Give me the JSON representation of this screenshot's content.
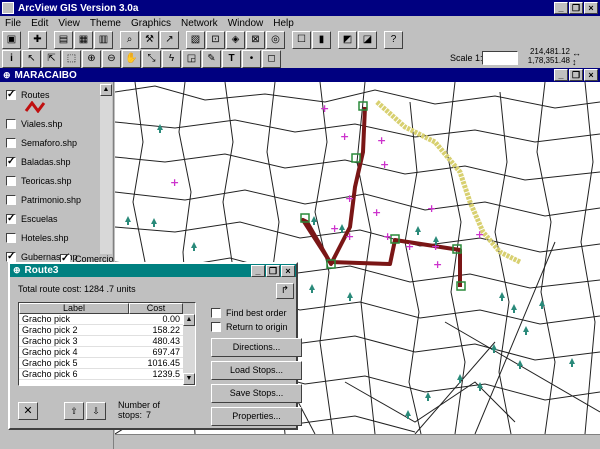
{
  "app": {
    "title": "ArcView GIS Version 3.0a"
  },
  "menu": [
    "File",
    "Edit",
    "View",
    "Theme",
    "Graphics",
    "Network",
    "Window",
    "Help"
  ],
  "scale": {
    "label": "Scale 1:",
    "coord_x": "214,481.12",
    "coord_y": "1,78,351.48"
  },
  "view": {
    "title": "MARACAIBO"
  },
  "toc": {
    "items": [
      {
        "label": "Routes",
        "checked": true
      },
      {
        "label": "Viales.shp",
        "checked": false
      },
      {
        "label": "Semaforo.shp",
        "checked": false
      },
      {
        "label": "Baladas.shp",
        "checked": true
      },
      {
        "label": "Teoricas.shp",
        "checked": false
      },
      {
        "label": "Patrimonio.shp",
        "checked": false
      },
      {
        "label": "Escuelas",
        "checked": true
      },
      {
        "label": "Hoteles.shp",
        "checked": false
      },
      {
        "label": "Gubernas.shp",
        "checked": true
      },
      {
        "label": "Comercio",
        "checked": true
      }
    ]
  },
  "dialog": {
    "title": "Route3",
    "summary": "Total route cost: 1284 .7 units",
    "columns": [
      "Label",
      "Cost"
    ],
    "rows": [
      {
        "label": "Gracho pick",
        "cost": "0.00"
      },
      {
        "label": "Gracho pick 2",
        "cost": "158.22"
      },
      {
        "label": "Gracho pick 3",
        "cost": "480.43"
      },
      {
        "label": "Gracho pick 4",
        "cost": "697.47"
      },
      {
        "label": "Gracho pick 5",
        "cost": "1016.45"
      },
      {
        "label": "Gracho pick 6",
        "cost": "1239.5"
      }
    ],
    "find_best_order": "Find best order",
    "return_to_origin": "Return to origin",
    "buttons": {
      "directions": "Directions...",
      "load_stops": "Load Stops...",
      "save_stops": "Save Stops...",
      "properties": "Properties..."
    },
    "stops_label": "Number of stops:",
    "stops_value": "7"
  },
  "colors": {
    "titlebar": "#000080",
    "route": "#7a1616",
    "facility": "#cc33cc",
    "tree": "#2a8a7a",
    "road_highlight": "#d8d070"
  }
}
